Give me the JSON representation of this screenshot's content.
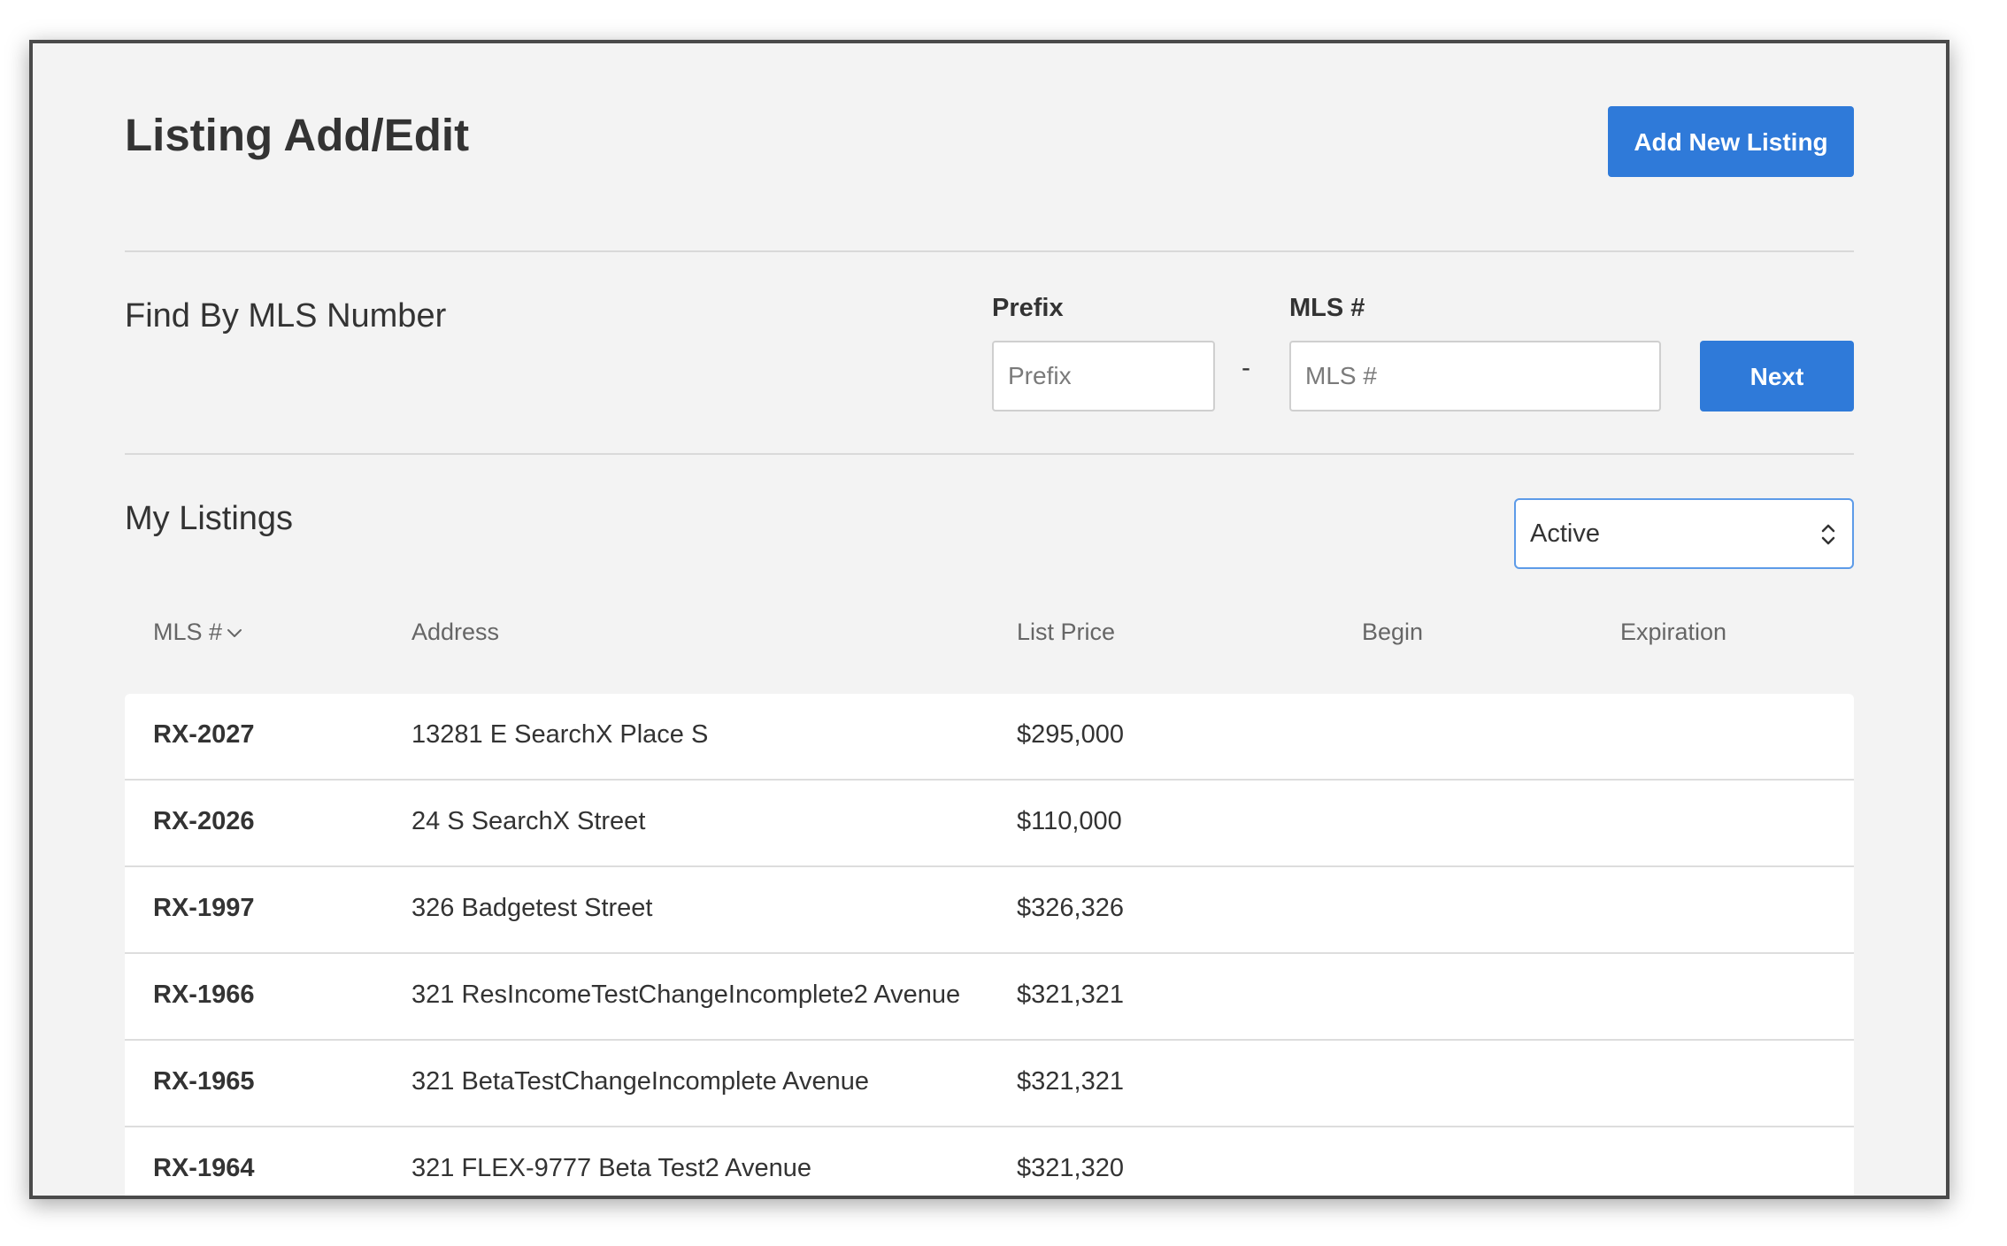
{
  "header": {
    "title": "Listing Add/Edit",
    "add_button_label": "Add New Listing"
  },
  "find": {
    "title": "Find By MLS Number",
    "prefix_label": "Prefix",
    "prefix_placeholder": "Prefix",
    "separator": "-",
    "mls_label": "MLS #",
    "mls_placeholder": "MLS #",
    "next_label": "Next"
  },
  "listings": {
    "title": "My Listings",
    "status_filter": "Active",
    "columns": {
      "mls": "MLS #",
      "address": "Address",
      "price": "List Price",
      "begin": "Begin",
      "expiration": "Expiration"
    },
    "rows": [
      {
        "mls": "RX-2027",
        "address": "13281 E SearchX Place S",
        "price": "$295,000",
        "begin": "",
        "expiration": ""
      },
      {
        "mls": "RX-2026",
        "address": "24 S SearchX Street",
        "price": "$110,000",
        "begin": "",
        "expiration": ""
      },
      {
        "mls": "RX-1997",
        "address": "326 Badgetest Street",
        "price": "$326,326",
        "begin": "",
        "expiration": ""
      },
      {
        "mls": "RX-1966",
        "address": "321 ResIncomeTestChangeIncomplete2 Avenue",
        "price": "$321,321",
        "begin": "",
        "expiration": ""
      },
      {
        "mls": "RX-1965",
        "address": "321 BetaTestChangeIncomplete Avenue",
        "price": "$321,321",
        "begin": "",
        "expiration": ""
      },
      {
        "mls": "RX-1964",
        "address": "321 FLEX-9777 Beta Test2 Avenue",
        "price": "$321,320",
        "begin": "",
        "expiration": ""
      }
    ]
  },
  "colors": {
    "primary": "#2f7ad9",
    "background": "#f3f3f3",
    "select_border": "#5d9be8"
  }
}
